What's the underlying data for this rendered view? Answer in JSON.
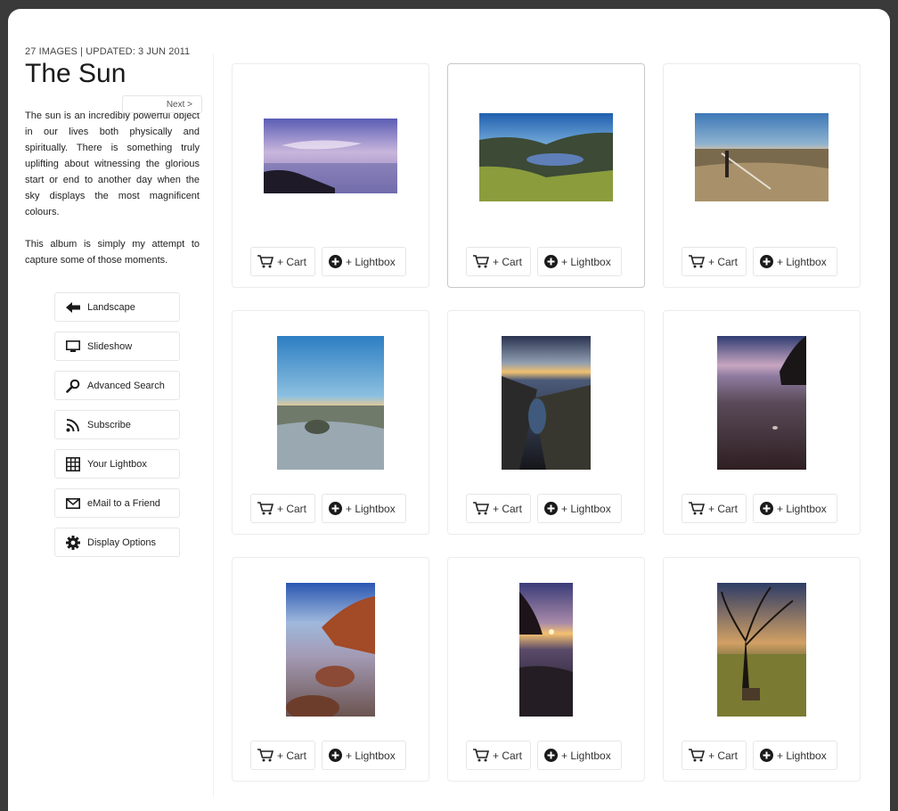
{
  "album": {
    "meta": "27 IMAGES | UPDATED: 3 JUN 2011",
    "title": "The Sun",
    "next_label": "Next >",
    "description": [
      "The sun is an incredibly powerful object in our lives both physically and spiritually. There is something truly uplifting about witnessing the glorious start or end to another day when the sky displays the most magnificent colours.",
      "This album is simply my attempt to capture some of those moments."
    ]
  },
  "menu": [
    {
      "label": "Landscape",
      "icon": "back-arrow-icon"
    },
    {
      "label": "Slideshow",
      "icon": "monitor-icon"
    },
    {
      "label": "Advanced Search",
      "icon": "search-icon"
    },
    {
      "label": "Subscribe",
      "icon": "rss-icon"
    },
    {
      "label": "Your Lightbox",
      "icon": "grid-icon"
    },
    {
      "label": "eMail to a Friend",
      "icon": "mail-icon"
    },
    {
      "label": "Display Options",
      "icon": "gear-icon"
    }
  ],
  "buttons": {
    "cart": "+ Cart",
    "lightbox": "+ Lightbox"
  },
  "photos": [
    {
      "orientation": "landscape",
      "scene": "seascape-purple-dusk",
      "selected": false
    },
    {
      "orientation": "landscape",
      "scene": "mountain-lake-valley",
      "selected": true
    },
    {
      "orientation": "landscape",
      "scene": "moorland-fence-dusk",
      "selected": false
    },
    {
      "orientation": "portrait",
      "scene": "frosty-grass-blue-sky",
      "selected": false
    },
    {
      "orientation": "portrait",
      "scene": "rocky-shore-clouds",
      "selected": false
    },
    {
      "orientation": "portrait",
      "scene": "beach-cliff-twilight",
      "selected": false
    },
    {
      "orientation": "portrait",
      "scene": "red-rocks-coast",
      "selected": false
    },
    {
      "orientation": "portrait",
      "scene": "sunset-cliff-rocks",
      "selected": false
    },
    {
      "orientation": "portrait",
      "scene": "bare-trees-sunset",
      "selected": false
    }
  ],
  "colors": {
    "frame_bg": "#3a3a3a",
    "card_border": "#ececec",
    "selected_border": "#c8c8c8"
  }
}
